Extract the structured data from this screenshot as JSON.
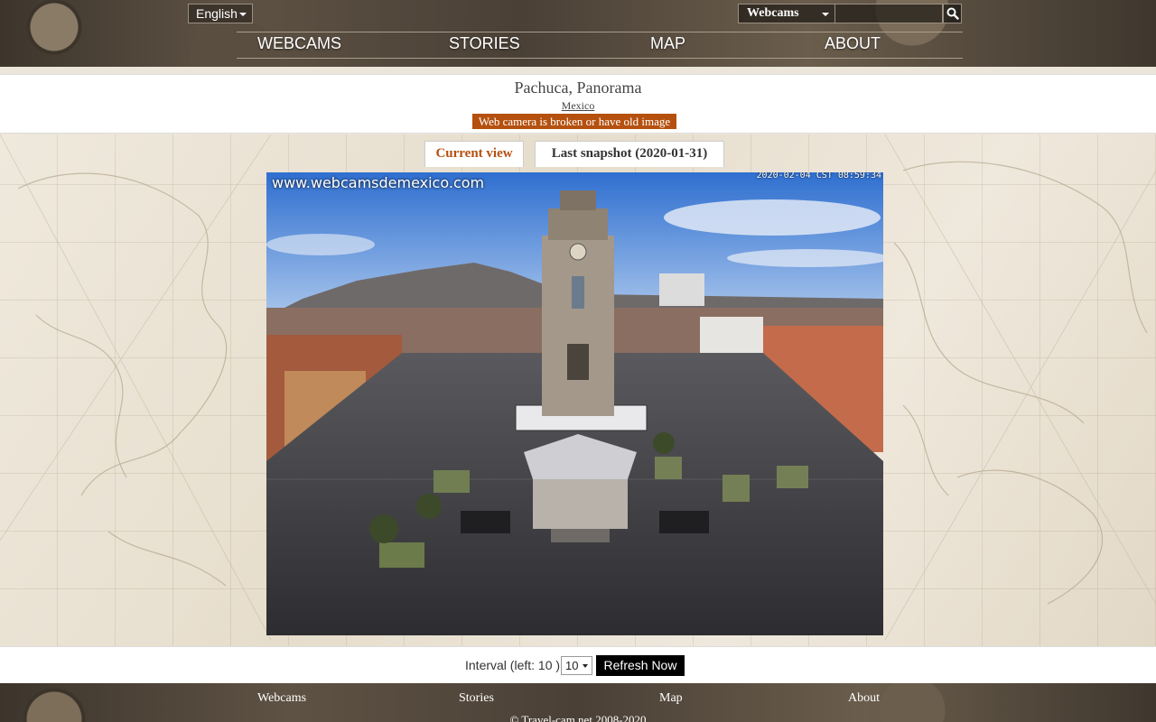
{
  "header": {
    "language": "English",
    "search_type": "Webcams",
    "search_value": "",
    "search_placeholder": "",
    "nav": [
      {
        "label": "WEBCAMS"
      },
      {
        "label": "STORIES"
      },
      {
        "label": "MAP"
      },
      {
        "label": "ABOUT"
      }
    ]
  },
  "camera": {
    "title": "Pachuca, Panorama",
    "country": "Mexico",
    "warning": "Web camera is broken or have old image",
    "tabs": {
      "current": "Current view",
      "snapshot": "Last snapshot (2020-01-31)"
    },
    "watermark": "www.webcamsdemexico.com",
    "timestamp": "2020-02-04 CST 08:59:34"
  },
  "refresh": {
    "interval_label": "Interval (left: 10 )",
    "interval_value": "10",
    "button_label": "Refresh Now"
  },
  "footer": {
    "links": [
      {
        "label": "Webcams"
      },
      {
        "label": "Stories"
      },
      {
        "label": "Map"
      },
      {
        "label": "About"
      }
    ],
    "copyright": "© Travel-cam.net 2008-2020"
  },
  "colors": {
    "accent": "#b5500f",
    "header_bg": "#4a4036"
  },
  "icons": {
    "search": "search-icon",
    "dropdown": "chevron-down-icon"
  }
}
